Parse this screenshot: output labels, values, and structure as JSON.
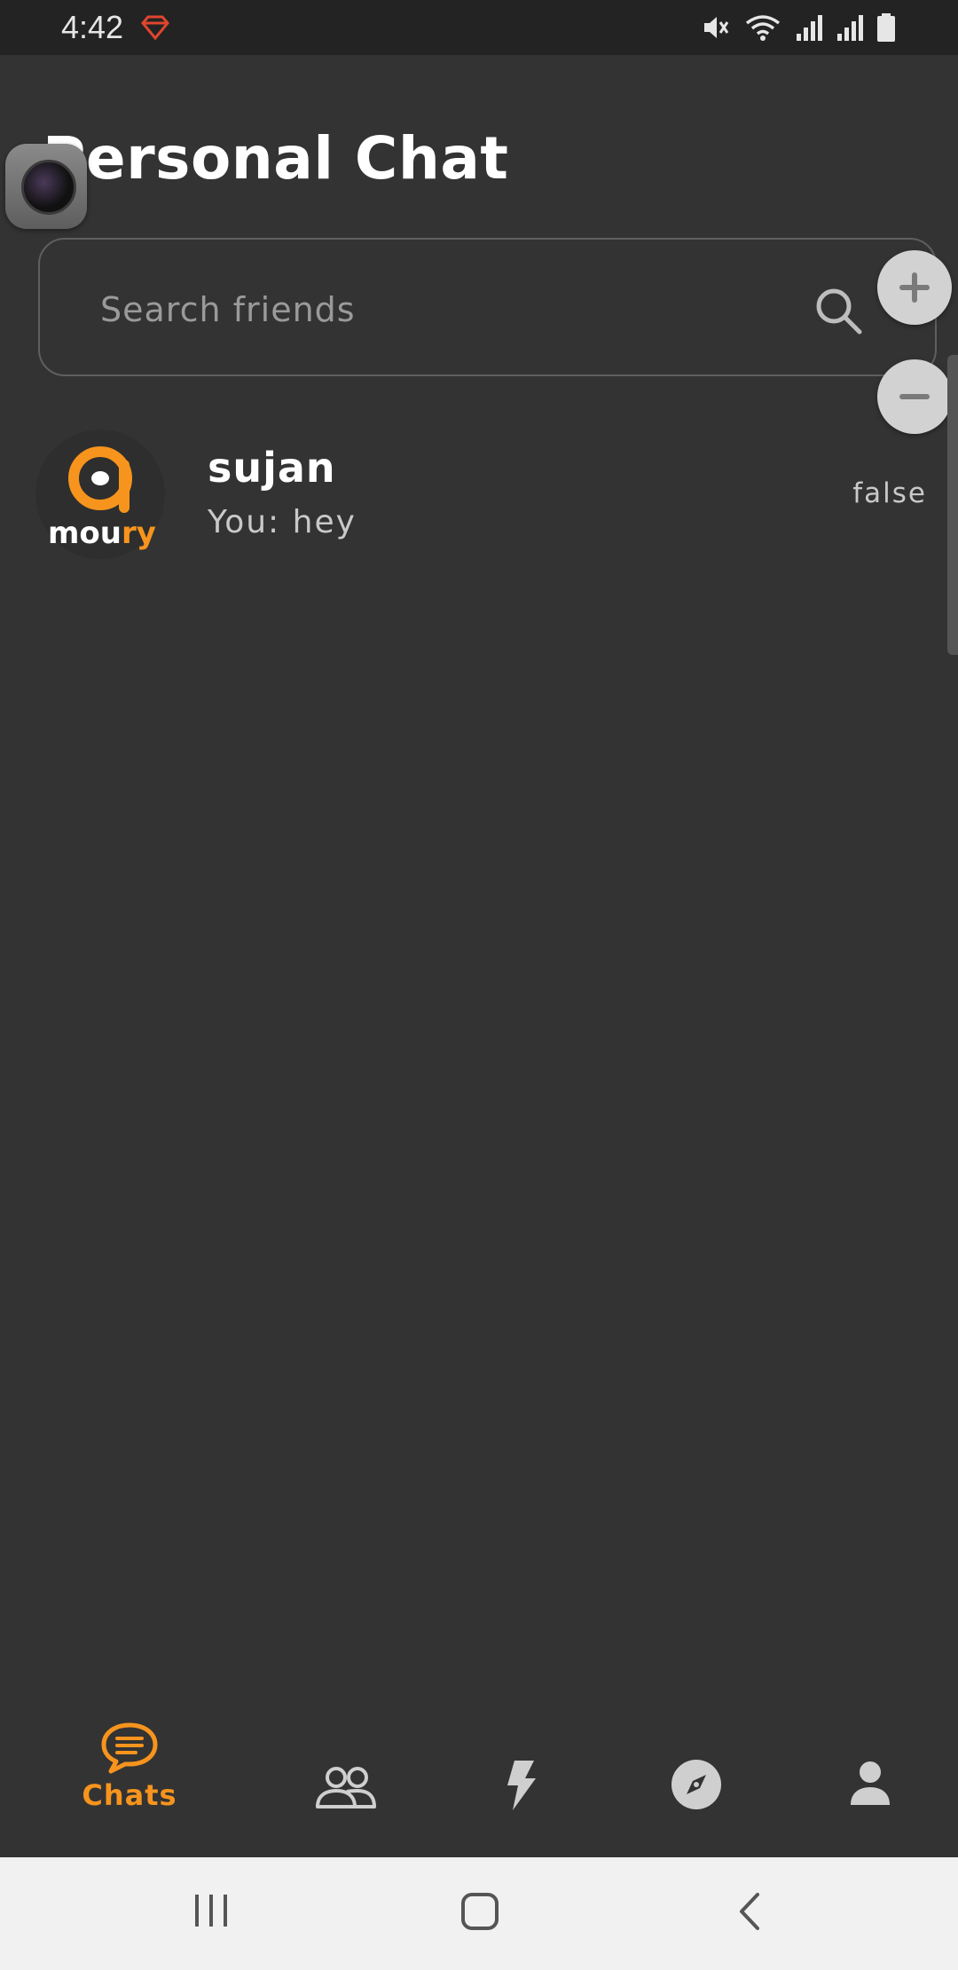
{
  "status_bar": {
    "time": "4:42",
    "icons": [
      "gem-icon",
      "mute-icon",
      "wifi-icon",
      "signal-icon",
      "signal-icon",
      "battery-icon"
    ]
  },
  "header": {
    "title": "Personal Chat"
  },
  "search": {
    "placeholder": "Search friends",
    "value": ""
  },
  "chats": [
    {
      "name": "sujan",
      "preview": "You: hey",
      "status": "false",
      "avatar_text": "moury"
    }
  ],
  "bottom_nav": {
    "items": [
      {
        "id": "chats",
        "label": "Chats",
        "icon": "chat-bubble-icon",
        "active": true
      },
      {
        "id": "friends",
        "label": "",
        "icon": "people-icon",
        "active": false
      },
      {
        "id": "flash",
        "label": "",
        "icon": "lightning-icon",
        "active": false
      },
      {
        "id": "explore",
        "label": "",
        "icon": "compass-icon",
        "active": false
      },
      {
        "id": "profile",
        "label": "",
        "icon": "person-icon",
        "active": false
      }
    ]
  },
  "colors": {
    "accent": "#f7941d",
    "background": "#333333",
    "status_bar": "#232323",
    "system_nav": "#f1f1f1"
  }
}
